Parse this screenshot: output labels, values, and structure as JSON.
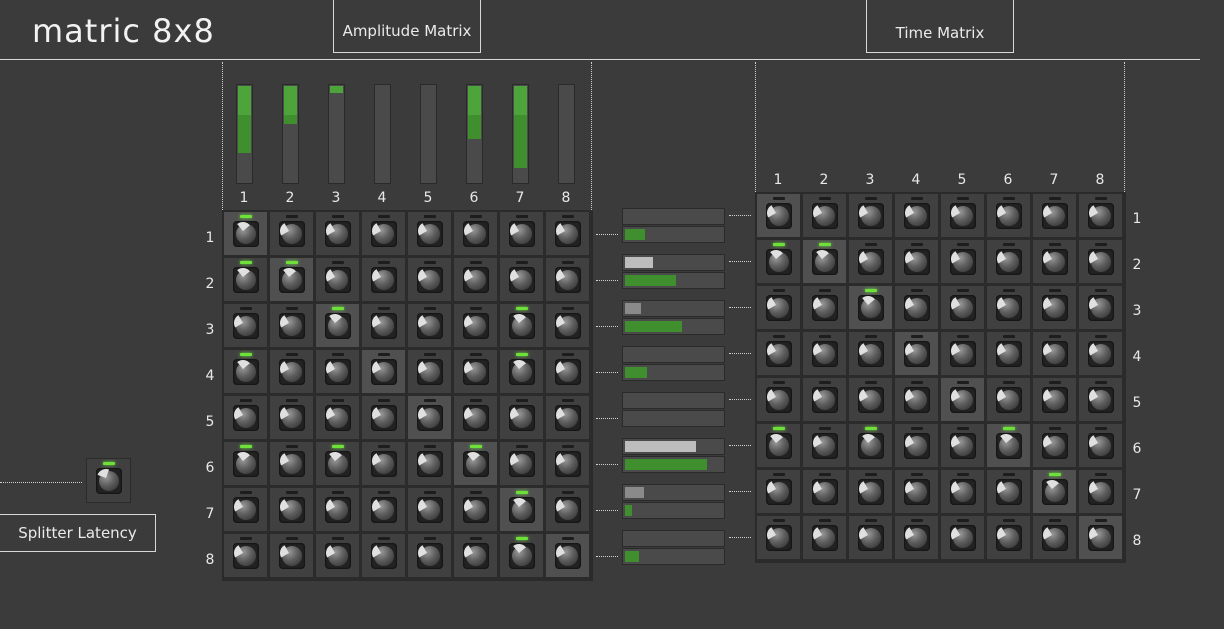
{
  "app": {
    "title": "matric 8x8",
    "amplitude_tab": "Amplitude Matrix",
    "time_tab": "Time Matrix",
    "latency_label": "Splitter Latency"
  },
  "column_labels": [
    "1",
    "2",
    "3",
    "4",
    "5",
    "6",
    "7",
    "8"
  ],
  "row_labels": [
    "1",
    "2",
    "3",
    "4",
    "5",
    "6",
    "7",
    "8"
  ],
  "input_levels": [
    {
      "peak": 0.3,
      "level": 0.7
    },
    {
      "peak": 0.6,
      "level": 0.4
    },
    {
      "peak": 0.93,
      "level": 0.07
    },
    {
      "peak": 0.0,
      "level": 0.0
    },
    {
      "peak": 0.0,
      "level": 0.0
    },
    {
      "peak": 0.45,
      "level": 0.55
    },
    {
      "peak": 0.15,
      "level": 0.85
    },
    {
      "peak": 0.0,
      "level": 0.0
    }
  ],
  "amplitude_matrix": [
    [
      1,
      0,
      0,
      0,
      0,
      0,
      0,
      0
    ],
    [
      1,
      1,
      0,
      0,
      0,
      0,
      0,
      0
    ],
    [
      0,
      0,
      1,
      0,
      0,
      0,
      1,
      0
    ],
    [
      1,
      0,
      0,
      0,
      0,
      0,
      1,
      0
    ],
    [
      0,
      0,
      0,
      0,
      0,
      0,
      0,
      0
    ],
    [
      1,
      0,
      1,
      0,
      0,
      1,
      0,
      0
    ],
    [
      0,
      0,
      0,
      0,
      0,
      0,
      1,
      0
    ],
    [
      0,
      0,
      0,
      0,
      0,
      0,
      1,
      0
    ]
  ],
  "amplitude_active": [
    [
      1,
      0,
      0,
      0,
      0,
      0,
      0,
      0
    ],
    [
      0,
      1,
      0,
      0,
      0,
      0,
      0,
      0
    ],
    [
      0,
      0,
      1,
      0,
      0,
      0,
      0,
      0
    ],
    [
      0,
      0,
      0,
      1,
      0,
      0,
      0,
      0
    ],
    [
      0,
      0,
      0,
      0,
      1,
      0,
      0,
      0
    ],
    [
      0,
      0,
      0,
      0,
      0,
      1,
      0,
      0
    ],
    [
      0,
      0,
      0,
      0,
      0,
      0,
      1,
      0
    ],
    [
      0,
      0,
      0,
      0,
      0,
      0,
      0,
      1
    ]
  ],
  "time_matrix": [
    [
      0,
      0,
      0,
      0,
      0,
      0,
      0,
      0
    ],
    [
      1,
      1,
      0,
      0,
      0,
      0,
      0,
      0
    ],
    [
      0,
      0,
      1,
      0,
      0,
      0,
      0,
      0
    ],
    [
      0,
      0,
      0,
      0,
      0,
      0,
      0,
      0
    ],
    [
      0,
      0,
      0,
      0,
      0,
      0,
      0,
      0
    ],
    [
      1,
      0,
      1,
      0,
      0,
      1,
      0,
      0
    ],
    [
      0,
      0,
      0,
      0,
      0,
      0,
      1,
      0
    ],
    [
      0,
      0,
      0,
      0,
      0,
      0,
      0,
      0
    ]
  ],
  "time_active": [
    [
      1,
      0,
      0,
      0,
      0,
      0,
      0,
      0
    ],
    [
      0,
      1,
      0,
      0,
      0,
      0,
      0,
      0
    ],
    [
      0,
      0,
      1,
      0,
      0,
      0,
      0,
      0
    ],
    [
      0,
      0,
      0,
      1,
      0,
      0,
      0,
      0
    ],
    [
      0,
      0,
      0,
      0,
      1,
      0,
      0,
      0
    ],
    [
      0,
      0,
      0,
      0,
      0,
      1,
      0,
      0
    ],
    [
      0,
      0,
      0,
      0,
      0,
      0,
      1,
      0
    ],
    [
      0,
      0,
      0,
      0,
      0,
      0,
      0,
      1
    ]
  ],
  "output_meters": [
    {
      "top": 0.0,
      "top_style": "grey",
      "bottom": 0.21
    },
    {
      "top": 0.29,
      "top_style": "light",
      "bottom": 0.53
    },
    {
      "top": 0.16,
      "top_style": "grey",
      "bottom": 0.59
    },
    {
      "top": 0.0,
      "top_style": "grey",
      "bottom": 0.23
    },
    {
      "top": 0.0,
      "top_style": "grey",
      "bottom": 0.0
    },
    {
      "top": 0.73,
      "top_style": "light",
      "bottom": 0.85
    },
    {
      "top": 0.2,
      "top_style": "grey",
      "bottom": 0.07
    },
    {
      "top": 0.0,
      "top_style": "grey",
      "bottom": 0.14
    }
  ],
  "colors": {
    "accent": "#6de03a",
    "meter": "#3f8f2f",
    "background": "#3b3b3b"
  }
}
